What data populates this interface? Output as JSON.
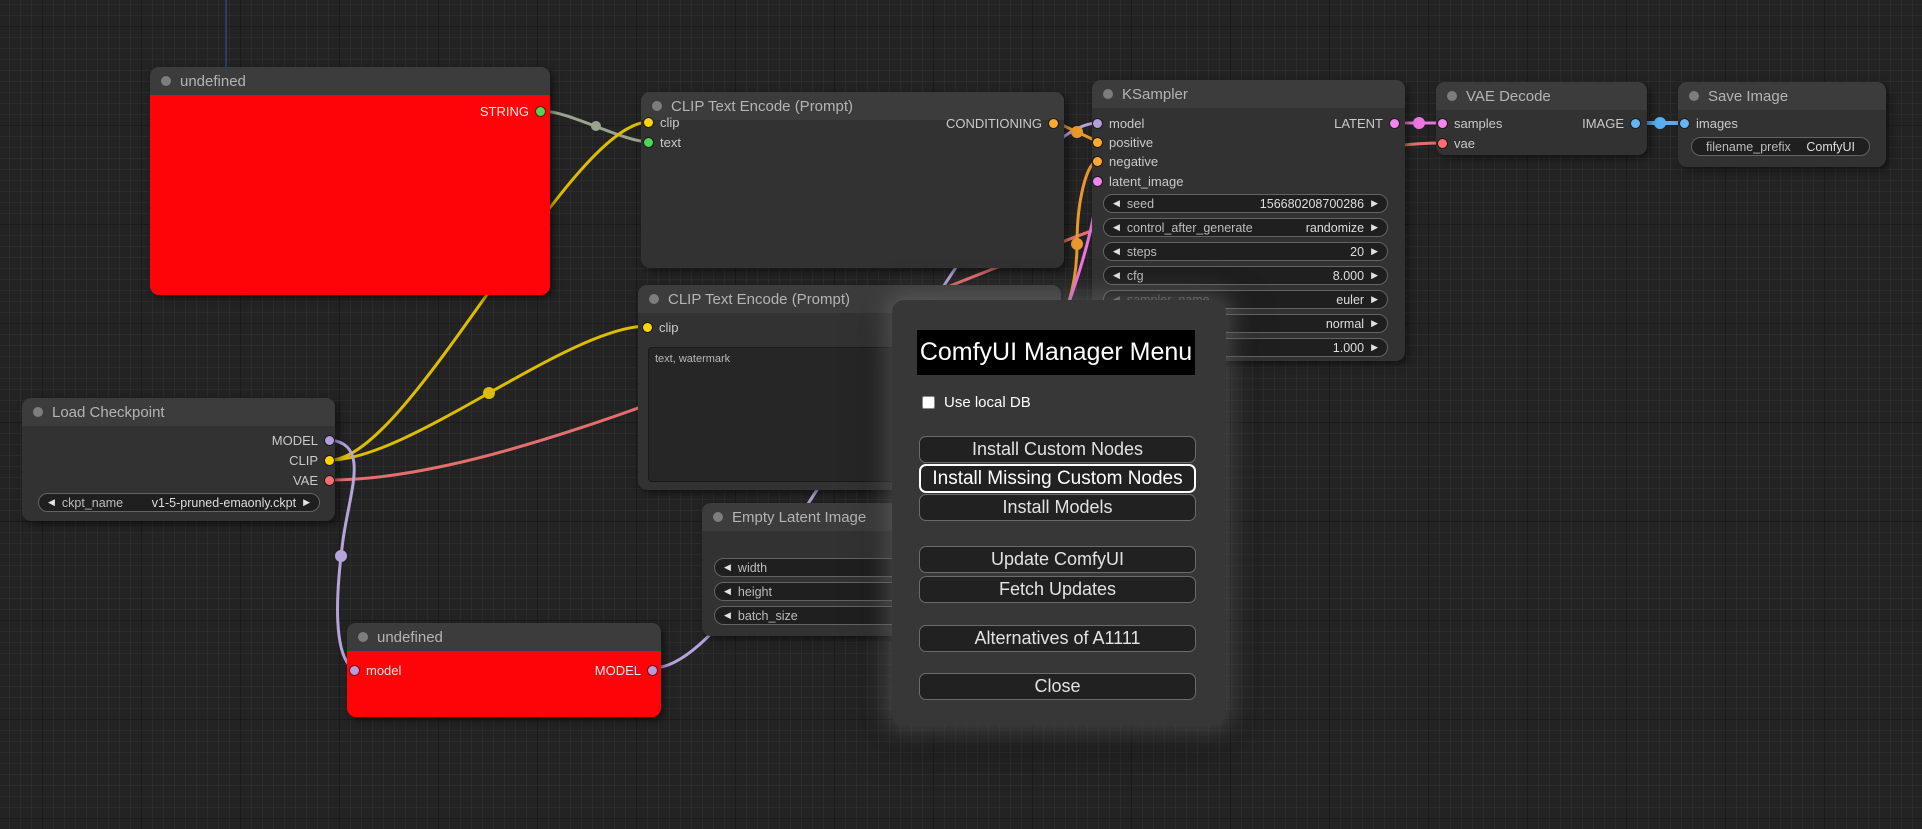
{
  "colors": {
    "model": "#b39ddb",
    "clip": "#ffd500",
    "vae": "#ff6e6e",
    "conditioning": "#ffa931",
    "latent": "#f485ec",
    "image": "#64b5f6",
    "string": "#4ad954",
    "wire_string": "#9aa38f",
    "wire_clip": "#dcbd00",
    "wire_vae": "#e56f6f",
    "wire_model": "#b4a4dc",
    "wire_cond": "#e9992c",
    "wire_latent": "#ee75e0",
    "wire_image": "#57aef2",
    "axis": "#2c3e66",
    "node_red": "#fe0409"
  },
  "icons": {
    "left_arrow": "◀",
    "right_arrow": "▶"
  },
  "nodes": {
    "undefined_top": {
      "title": "undefined",
      "output": "STRING"
    },
    "clip1": {
      "title": "CLIP Text Encode (Prompt)",
      "inputs": [
        "clip",
        "text"
      ],
      "output": "CONDITIONING"
    },
    "clip2": {
      "title": "CLIP Text Encode (Prompt)",
      "inputs": [
        "clip"
      ],
      "text_value": "text, watermark"
    },
    "ksampler": {
      "title": "KSampler",
      "inputs": [
        "model",
        "positive",
        "negative",
        "latent_image"
      ],
      "output": "LATENT",
      "widgets": [
        {
          "label": "seed",
          "value": "156680208700286"
        },
        {
          "label": "control_after_generate",
          "value": "randomize"
        },
        {
          "label": "steps",
          "value": "20"
        },
        {
          "label": "cfg",
          "value": "8.000"
        },
        {
          "label": "sampler_name",
          "value": "euler"
        },
        {
          "value": "normal"
        },
        {
          "value": "1.000"
        }
      ]
    },
    "vae_decode": {
      "title": "VAE Decode",
      "inputs": [
        "samples",
        "vae"
      ],
      "output": "IMAGE"
    },
    "save_image": {
      "title": "Save Image",
      "inputs": [
        "images"
      ],
      "widgets": [
        {
          "label": "filename_prefix",
          "value": "ComfyUI"
        }
      ]
    },
    "load_checkpoint": {
      "title": "Load Checkpoint",
      "outputs": [
        "MODEL",
        "CLIP",
        "VAE"
      ],
      "widgets": [
        {
          "label": "ckpt_name",
          "value": "v1-5-pruned-emaonly.ckpt"
        }
      ]
    },
    "empty_latent": {
      "title": "Empty Latent Image",
      "widgets": [
        {
          "label": "width"
        },
        {
          "label": "height"
        },
        {
          "label": "batch_size"
        }
      ]
    },
    "undefined_bottom": {
      "title": "undefined",
      "input": "model",
      "output": "MODEL"
    }
  },
  "dialog": {
    "title": "ComfyUI Manager Menu",
    "checkbox_label": "Use local DB",
    "buttons": [
      "Install Custom Nodes",
      "Install Missing Custom Nodes",
      "Install Models",
      "Update ComfyUI",
      "Fetch Updates",
      "Alternatives of A1111",
      "Close"
    ]
  }
}
